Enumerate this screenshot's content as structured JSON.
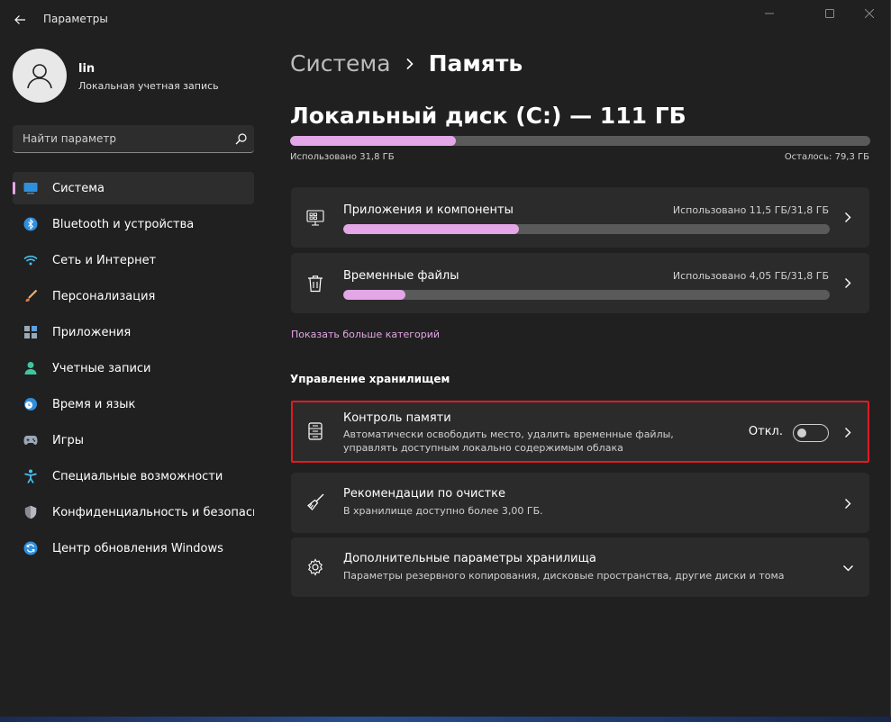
{
  "window": {
    "title": "Параметры"
  },
  "profile": {
    "name": "lin",
    "account_type": "Локальная учетная запись"
  },
  "search": {
    "placeholder": "Найти параметр"
  },
  "sidebar": {
    "items": [
      {
        "label": "Система",
        "icon": "system-icon",
        "active": true
      },
      {
        "label": "Bluetooth и устройства",
        "icon": "bluetooth-icon"
      },
      {
        "label": "Сеть и Интернет",
        "icon": "wifi-icon"
      },
      {
        "label": "Персонализация",
        "icon": "brush-icon"
      },
      {
        "label": "Приложения",
        "icon": "apps-icon"
      },
      {
        "label": "Учетные записи",
        "icon": "person-icon"
      },
      {
        "label": "Время и язык",
        "icon": "clock-globe-icon"
      },
      {
        "label": "Игры",
        "icon": "gamepad-icon"
      },
      {
        "label": "Специальные возможности",
        "icon": "accessibility-icon"
      },
      {
        "label": "Конфиденциальность и безопасность",
        "icon": "shield-icon"
      },
      {
        "label": "Центр обновления Windows",
        "icon": "update-icon"
      }
    ]
  },
  "breadcrumb": {
    "parent": "Система",
    "current": "Память"
  },
  "disk": {
    "title": "Локальный диск (C:) — 111 ГБ",
    "used_label": "Использовано 31,8 ГБ",
    "free_label": "Осталось: 79,3 ГБ",
    "used_fraction": 0.286
  },
  "categories": [
    {
      "title": "Приложения и компоненты",
      "meta": "Использовано 11,5 ГБ/31,8 ГБ",
      "fraction": 0.362,
      "icon": "apps-features-icon"
    },
    {
      "title": "Временные файлы",
      "meta": "Использовано 4,05 ГБ/31,8 ГБ",
      "fraction": 0.127,
      "icon": "trash-icon"
    }
  ],
  "more_categories_link": "Показать больше категорий",
  "management": {
    "section_title": "Управление хранилищем",
    "storage_sense": {
      "title": "Контроль памяти",
      "desc_line1": "Автоматически освободить место, удалить временные файлы,",
      "desc_line2": "управлять доступным локально содержимым облака",
      "toggle_label": "Откл.",
      "toggle_on": false
    },
    "cleanup": {
      "title": "Рекомендации по очистке",
      "desc": "В хранилище доступно более 3,00 ГБ."
    },
    "advanced": {
      "title": "Дополнительные параметры хранилища",
      "desc": "Параметры резервного копирования, дисковые пространства, другие диски и тома"
    }
  },
  "colors": {
    "accent": "#e3a6e6",
    "highlight_border": "#e11b22",
    "card_bg": "#2b2b2b",
    "window_bg": "#202020"
  }
}
